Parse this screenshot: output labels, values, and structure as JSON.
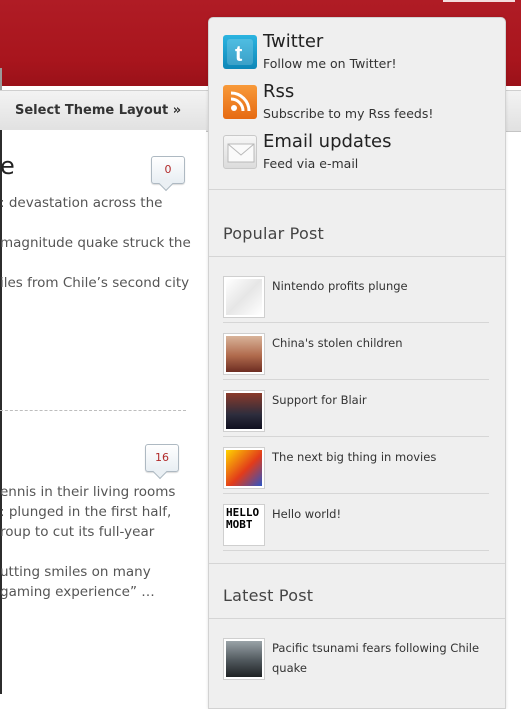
{
  "nav": {
    "theme_layout_link": "Select Theme Layout »"
  },
  "content": {
    "post1": {
      "title_fragment": "e",
      "comments": "0",
      "excerpt_lines": [
        ": devastation across the",
        "magnitude quake struck the",
        "iles from Chile’s second city"
      ]
    },
    "post2": {
      "comments": "16",
      "excerpt_lines": [
        "ennis in their living rooms",
        ": plunged in the first half,",
        "roup to cut its full-year",
        "utting smiles on many",
        "gaming experience” …"
      ]
    }
  },
  "sidebar": {
    "subscribe": [
      {
        "icon": "twitter-icon",
        "title": "Twitter",
        "desc": "Follow me on Twitter!"
      },
      {
        "icon": "rss-icon",
        "title": "Rss",
        "desc": "Subscribe to my Rss feeds!"
      },
      {
        "icon": "email-icon",
        "title": "Email updates",
        "desc": "Feed via e-mail"
      }
    ],
    "popular_heading": "Popular Post",
    "popular_posts": [
      {
        "title": "Nintendo profits plunge"
      },
      {
        "title": "China's stolen children"
      },
      {
        "title": "Support for Blair"
      },
      {
        "title": "The next big thing in movies"
      },
      {
        "title": "Hello world!",
        "thumb_text": "HELLO MOBT"
      }
    ],
    "latest_heading": "Latest Post",
    "latest_posts": [
      {
        "title_line1": "Pacific tsunami fears following Chile",
        "title_line2": "quake"
      }
    ]
  },
  "colors": {
    "header_red": "#a8151d",
    "sidebar_bg": "#efefef",
    "comment_count": "#b12a2a"
  }
}
